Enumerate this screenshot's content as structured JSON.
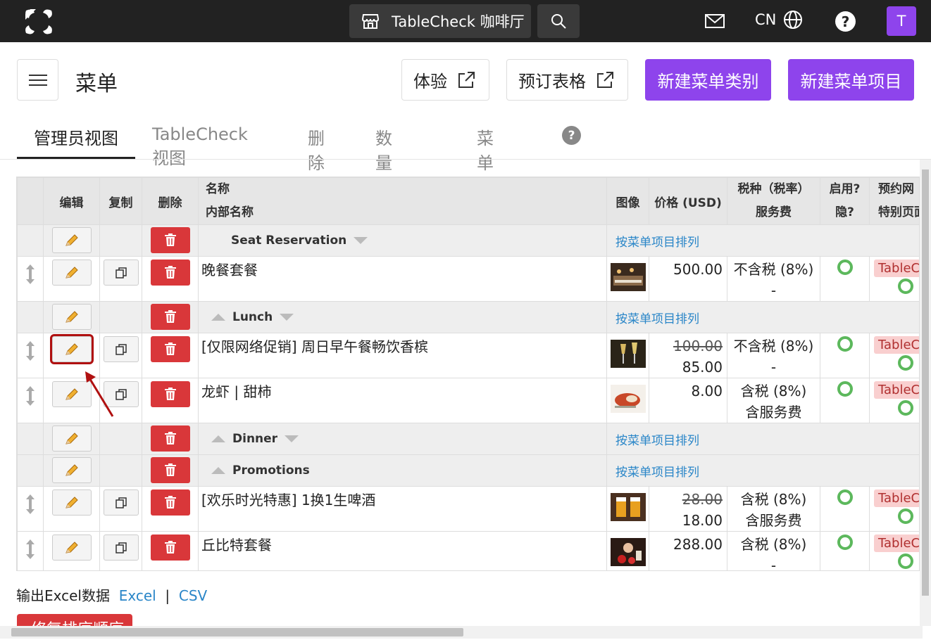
{
  "topbar": {
    "store_name": "TableCheck 咖啡厅",
    "lang": "CN",
    "help": "?",
    "avatar": "T"
  },
  "header": {
    "title": "菜单",
    "experience_btn": "体验",
    "booking_btn": "预订表格",
    "new_category_btn": "新建菜单类别",
    "new_item_btn": "新建菜单项目"
  },
  "tabs": [
    {
      "label": "管理员视图",
      "active": true
    },
    {
      "label": "TableCheck视图"
    },
    {
      "label": "删除"
    },
    {
      "label": "数量上限"
    },
    {
      "label": "菜单列表"
    }
  ],
  "tab_help": "?",
  "table": {
    "headers": {
      "edit": "编辑",
      "copy": "复制",
      "delete": "删除",
      "name": "名称",
      "internal_name": "内部名称",
      "image": "图像",
      "price": "价格 (USD)",
      "tax": "税种（税率）",
      "service": "服务费",
      "enabled": "启用?",
      "hidden": "隐?",
      "booking_web": "预约网",
      "special_page": "特别页面"
    },
    "sort_label": "按菜单项目排列",
    "rows": [
      {
        "type": "category",
        "name": "Seat Reservation"
      },
      {
        "type": "item",
        "name": "晚餐套餐",
        "price": "500.00",
        "tax": "不含税 (8%)",
        "service": "-",
        "badge": "TableCh"
      },
      {
        "type": "category",
        "name": "Lunch"
      },
      {
        "type": "item",
        "name": "[仅限网络促销] 周日早午餐畅饮香槟",
        "old_price": "100.00",
        "price": "85.00",
        "tax": "不含税 (8%)",
        "service": "-",
        "badge": "TableCh",
        "highlight": true
      },
      {
        "type": "item",
        "name": "龙虾 | 甜柿",
        "price": "8.00",
        "tax": "含税 (8%)",
        "service": "含服务费",
        "badge": "TableCh"
      },
      {
        "type": "category",
        "name": "Dinner"
      },
      {
        "type": "category",
        "name": "Promotions"
      },
      {
        "type": "item",
        "name": "[欢乐时光特惠] 1换1生啤酒",
        "old_price": "28.00",
        "price": "18.00",
        "tax": "含税 (8%)",
        "service": "含服务费",
        "badge": "TableCh"
      },
      {
        "type": "item",
        "name": "丘比特套餐",
        "price": "288.00",
        "tax": "含税 (8%)",
        "service": "-",
        "badge": "TableCh"
      }
    ]
  },
  "export": {
    "label": "输出Excel数据",
    "excel": "Excel",
    "sep": "|",
    "csv": "CSV"
  },
  "bottom_button": "修复排序顺序",
  "colors": {
    "accent": "#8e44ec",
    "danger": "#d9373a",
    "link": "#2a86c8",
    "topbar": "#222222"
  }
}
